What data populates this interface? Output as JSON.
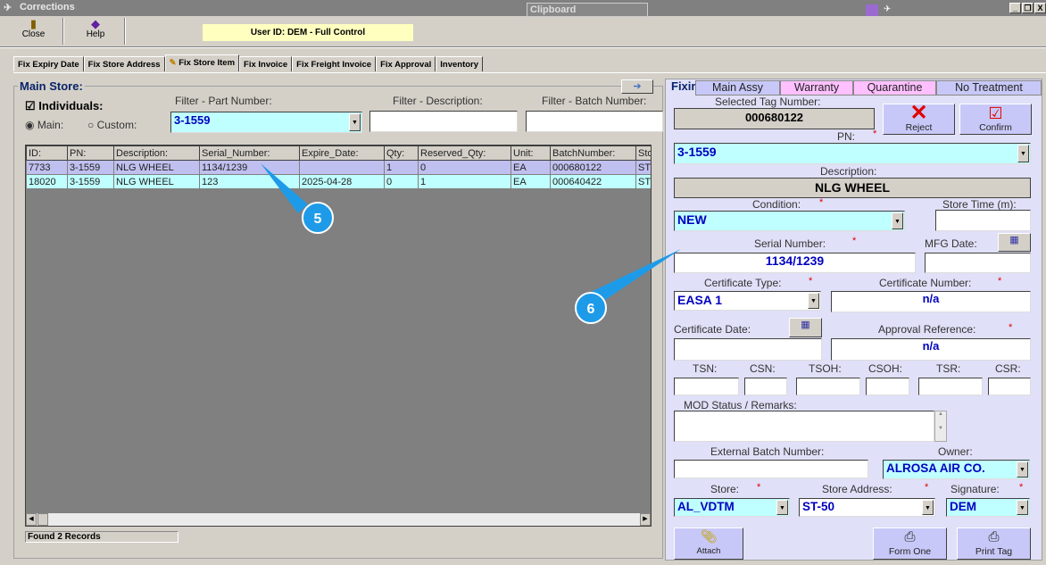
{
  "window": {
    "title": "Corrections",
    "clipboard": "Clipboard",
    "controls": [
      "_",
      "❐",
      "X"
    ]
  },
  "toolbar": {
    "close": "Close",
    "help": "Help",
    "user": "User ID: DEM - Full Control"
  },
  "tabs": [
    "Fix Expiry Date",
    "Fix Store Address",
    "Fix Store Item",
    "Fix Invoice",
    "Fix Freight Invoice",
    "Fix Approval",
    "Inventory"
  ],
  "active_tab": "Fix Store Item",
  "main_store": {
    "title": "Main Store:",
    "individuals": "Individuals:",
    "individuals_checked": true,
    "radio_main": "Main:",
    "radio_custom": "Custom:",
    "radio_selected": "Main",
    "filter_pn_label": "Filter - Part Number:",
    "filter_pn_value": "3-1559",
    "filter_desc_label": "Filter - Description:",
    "filter_desc_value": "",
    "filter_batch_label": "Filter - Batch Number:",
    "filter_batch_value": "",
    "columns": [
      "ID:",
      "PN:",
      "Description:",
      "Serial_Number:",
      "Expire_Date:",
      "Qty:",
      "Reserved_Qty:",
      "Unit:",
      "BatchNumber:",
      "Sto"
    ],
    "rows": [
      [
        "7733",
        "3-1559",
        "NLG WHEEL",
        "1134/1239",
        "",
        "1",
        "0",
        "EA",
        "000680122",
        "ST-"
      ],
      [
        "18020",
        "3-1559",
        "NLG WHEEL",
        "123",
        "2025-04-28",
        "0",
        "1",
        "EA",
        "000640422",
        "ST-"
      ]
    ],
    "status": "Found 2 Records"
  },
  "callouts": [
    "5",
    "6"
  ],
  "fixing": {
    "title": "Fixir",
    "tabs": [
      "Main Assy",
      "Warranty",
      "Quarantine",
      "No Treatment"
    ],
    "tag_label": "Selected Tag Number:",
    "tag": "000680122",
    "reject": "Reject",
    "confirm": "Confirm",
    "pn_label": "PN:",
    "pn": "3-1559",
    "desc_label": "Description:",
    "desc": "NLG WHEEL",
    "cond_label": "Condition:",
    "cond": "NEW",
    "store_time_label": "Store Time (m):",
    "store_time": "",
    "serial_label": "Serial Number:",
    "serial": "1134/1239",
    "mfg_label": "MFG Date:",
    "mfg": "",
    "cert_type_label": "Certificate Type:",
    "cert_type": "EASA 1",
    "cert_num_label": "Certificate Number:",
    "cert_num": "n/a",
    "cert_date_label": "Certificate Date:",
    "cert_date": "",
    "approval_label": "Approval Reference:",
    "approval": "n/a",
    "times": [
      "TSN:",
      "CSN:",
      "TSOH:",
      "CSOH:",
      "TSR:",
      "CSR:"
    ],
    "mod_label": "MOD Status / Remarks:",
    "mod": "",
    "ext_batch_label": "External Batch Number:",
    "ext_batch": "",
    "owner_label": "Owner:",
    "owner": "ALROSA AIR CO.",
    "store_label": "Store:",
    "store": "AL_VDTM",
    "address_label": "Store Address:",
    "address": "ST-50",
    "signature_label": "Signature:",
    "signature": "DEM",
    "attach": "Attach",
    "form_one": "Form One",
    "print_tag": "Print Tag",
    "required": "*"
  },
  "colors": {
    "cyan_field": "#c0ffff",
    "panel": "#e0e0f8",
    "selected_row": "#c0c0f0",
    "callout": "#1e9be8"
  }
}
